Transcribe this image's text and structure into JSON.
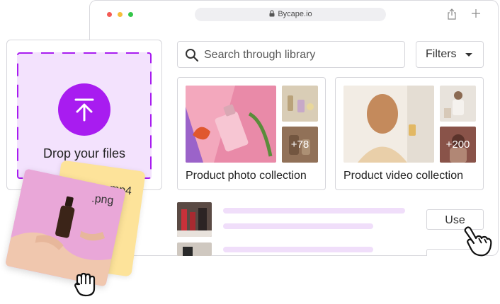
{
  "browser": {
    "url": "Bycape.io",
    "icons": [
      "lock-icon",
      "share-icon",
      "new-tab-icon"
    ]
  },
  "search": {
    "placeholder": "Search through library",
    "icon": "search-icon"
  },
  "filters": {
    "label": "Filters",
    "icon": "caret-down-icon"
  },
  "collections": [
    {
      "title": "Product photo collection",
      "more_count": "+78"
    },
    {
      "title": "Product video collection",
      "more_count": "+200"
    }
  ],
  "list": {
    "use_label": "Use"
  },
  "drop_zone": {
    "label": "Drop your files",
    "icon": "upload-arrow-icon"
  },
  "files": [
    {
      "extension": ".mp4"
    },
    {
      "extension": ".png"
    }
  ],
  "colors": {
    "accent": "#a81cf0",
    "drop_zone_bg": "#f3e2fd",
    "placeholder_bar": "#f0defa",
    "mp4_card": "#fde39a",
    "png_card": "#e9a7d8"
  }
}
